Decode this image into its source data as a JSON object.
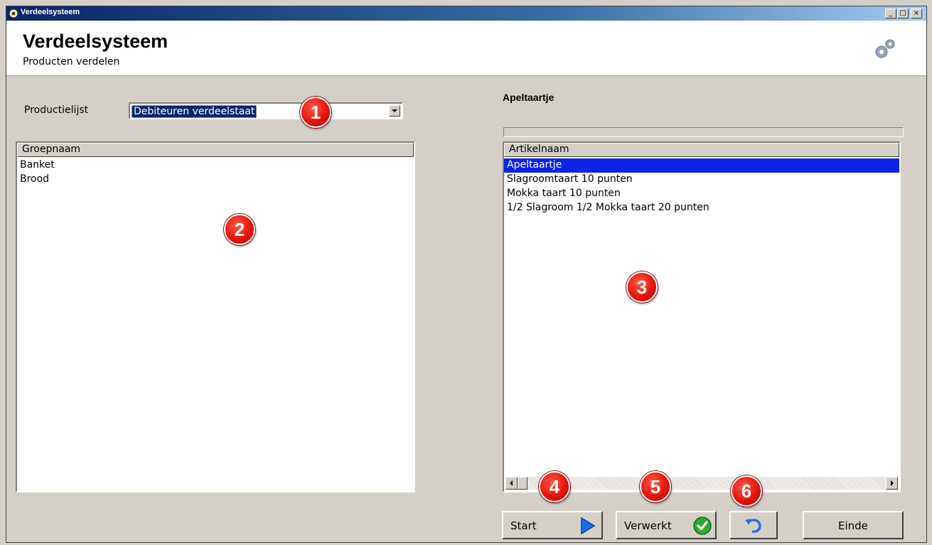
{
  "window": {
    "title": "Verdeelsysteem",
    "minimize": "_",
    "maximize": "□",
    "close": "×"
  },
  "header": {
    "title": "Verdeelsysteem",
    "subtitle": "Producten verdelen",
    "icon": "gears-icon"
  },
  "left": {
    "productielijst_label": "Productielijst",
    "productielijst_value": "Debiteuren verdeelstaat",
    "groups_header": "Groepnaam",
    "groups": [
      "Banket",
      "Brood"
    ]
  },
  "right": {
    "current_item": "Apeltaartje",
    "articles_header": "Artikelnaam",
    "articles": [
      "Apeltaartje",
      "Slagroomtaart 10 punten",
      "Mokka taart 10 punten",
      "1/2 Slagroom 1/2 Mokka taart 20 punten"
    ],
    "selected_index": 0
  },
  "buttons": {
    "start": "Start",
    "verwerkt": "Verwerkt",
    "undo_icon": "undo-icon",
    "einde": "Einde"
  },
  "badges": [
    "1",
    "2",
    "3",
    "4",
    "5",
    "6"
  ],
  "colors": {
    "selection": "#0a24e8",
    "titlebar": "#0a246a",
    "badge": "#e8140a",
    "start_arrow": "#1a6fe8",
    "check": "#2fa82f"
  }
}
